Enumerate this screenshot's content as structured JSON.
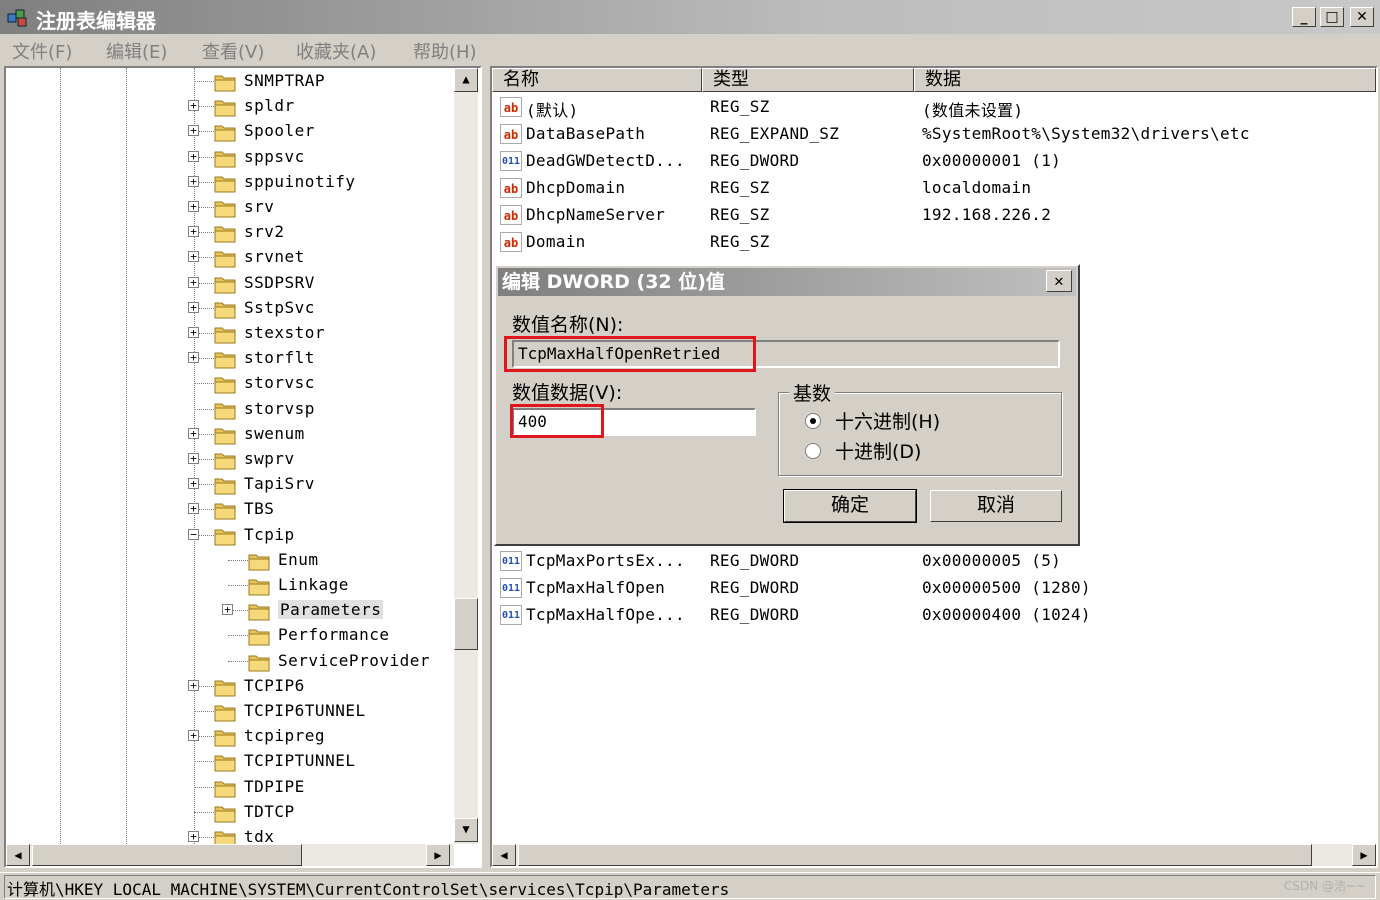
{
  "window": {
    "title": "注册表编辑器",
    "min": "_",
    "max": "□",
    "close": "✕"
  },
  "menu": [
    "文件(F)",
    "编辑(E)",
    "查看(V)",
    "收藏夹(A)",
    "帮助(H)"
  ],
  "tree": [
    {
      "label": "SNMPTRAP",
      "level": 0,
      "expander": ""
    },
    {
      "label": "spldr",
      "level": 0,
      "expander": "+"
    },
    {
      "label": "Spooler",
      "level": 0,
      "expander": "+"
    },
    {
      "label": "sppsvc",
      "level": 0,
      "expander": "+"
    },
    {
      "label": "sppuinotify",
      "level": 0,
      "expander": "+"
    },
    {
      "label": "srv",
      "level": 0,
      "expander": "+"
    },
    {
      "label": "srv2",
      "level": 0,
      "expander": "+"
    },
    {
      "label": "srvnet",
      "level": 0,
      "expander": "+"
    },
    {
      "label": "SSDPSRV",
      "level": 0,
      "expander": "+"
    },
    {
      "label": "SstpSvc",
      "level": 0,
      "expander": "+"
    },
    {
      "label": "stexstor",
      "level": 0,
      "expander": "+"
    },
    {
      "label": "storflt",
      "level": 0,
      "expander": "+"
    },
    {
      "label": "storvsc",
      "level": 0,
      "expander": ""
    },
    {
      "label": "storvsp",
      "level": 0,
      "expander": ""
    },
    {
      "label": "swenum",
      "level": 0,
      "expander": "+"
    },
    {
      "label": "swprv",
      "level": 0,
      "expander": "+"
    },
    {
      "label": "TapiSrv",
      "level": 0,
      "expander": "+"
    },
    {
      "label": "TBS",
      "level": 0,
      "expander": "+"
    },
    {
      "label": "Tcpip",
      "level": 0,
      "expander": "−"
    },
    {
      "label": "Enum",
      "level": 1,
      "expander": ""
    },
    {
      "label": "Linkage",
      "level": 1,
      "expander": ""
    },
    {
      "label": "Parameters",
      "level": 1,
      "expander": "+",
      "selected": true
    },
    {
      "label": "Performance",
      "level": 1,
      "expander": ""
    },
    {
      "label": "ServiceProvider",
      "level": 1,
      "expander": ""
    },
    {
      "label": "TCPIP6",
      "level": 0,
      "expander": "+"
    },
    {
      "label": "TCPIP6TUNNEL",
      "level": 0,
      "expander": ""
    },
    {
      "label": "tcpipreg",
      "level": 0,
      "expander": "+"
    },
    {
      "label": "TCPIPTUNNEL",
      "level": 0,
      "expander": ""
    },
    {
      "label": "TDPIPE",
      "level": 0,
      "expander": ""
    },
    {
      "label": "TDTCP",
      "level": 0,
      "expander": ""
    },
    {
      "label": "tdx",
      "level": 0,
      "expander": "+"
    }
  ],
  "columns": {
    "name": "名称",
    "type": "类型",
    "data": "数据"
  },
  "values_top": [
    {
      "icon": "ab",
      "kind": "sz",
      "name": "(默认)",
      "type": "REG_SZ",
      "data": "(数值未设置)"
    },
    {
      "icon": "ab",
      "kind": "sz",
      "name": "DataBasePath",
      "type": "REG_EXPAND_SZ",
      "data": "%SystemRoot%\\System32\\drivers\\etc"
    },
    {
      "icon": "011",
      "kind": "dw",
      "name": "DeadGWDetectD...",
      "type": "REG_DWORD",
      "data": "0x00000001 (1)"
    },
    {
      "icon": "ab",
      "kind": "sz",
      "name": "DhcpDomain",
      "type": "REG_SZ",
      "data": "localdomain"
    },
    {
      "icon": "ab",
      "kind": "sz",
      "name": "DhcpNameServer",
      "type": "REG_SZ",
      "data": "192.168.226.2"
    },
    {
      "icon": "ab",
      "kind": "sz",
      "name": "Domain",
      "type": "REG_SZ",
      "data": ""
    }
  ],
  "values_bottom": [
    {
      "icon": "011",
      "kind": "dw",
      "name": "TcpMaxPortsEx...",
      "type": "REG_DWORD",
      "data": "0x00000005 (5)"
    },
    {
      "icon": "011",
      "kind": "dw",
      "name": "TcpMaxHalfOpen",
      "type": "REG_DWORD",
      "data": "0x00000500 (1280)"
    },
    {
      "icon": "011",
      "kind": "dw",
      "name": "TcpMaxHalfOpe...",
      "type": "REG_DWORD",
      "data": "0x00000400 (1024)"
    }
  ],
  "dialog": {
    "title": "编辑 DWORD (32 位)值",
    "close": "✕",
    "name_label": "数值名称(N):",
    "name_value": "TcpMaxHalfOpenRetried",
    "data_label": "数值数据(V):",
    "data_value": "400",
    "base_label": "基数",
    "hex_label": "十六进制(H)",
    "dec_label": "十进制(D)",
    "ok": "确定",
    "cancel": "取消"
  },
  "status": {
    "path": "计算机\\HKEY_LOCAL_MACHINE\\SYSTEM\\CurrentControlSet\\services\\Tcpip\\Parameters",
    "watermark": "CSDN @浩~~"
  },
  "colors": {
    "highlight": "#e0161e",
    "folder": "#e8c45a"
  }
}
